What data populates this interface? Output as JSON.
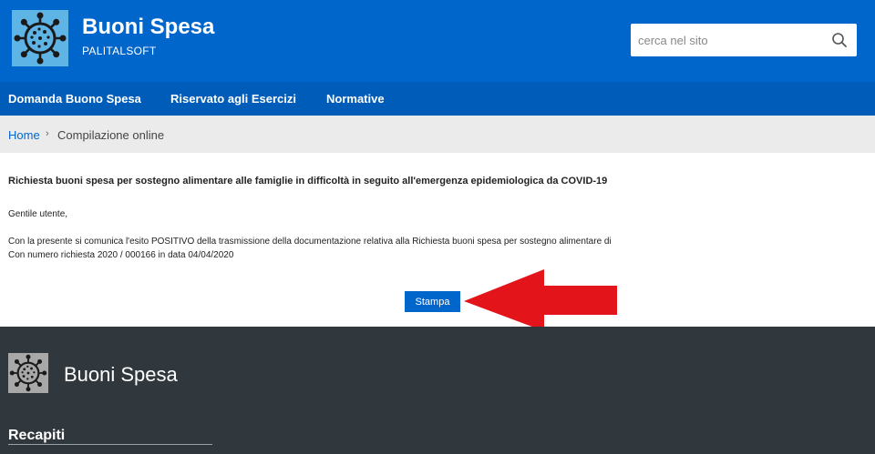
{
  "header": {
    "title": "Buoni Spesa",
    "subtitle": "PALITALSOFT",
    "logo_icon": "virus-icon",
    "search": {
      "placeholder": "cerca nel sito",
      "value": "",
      "icon": "search-icon"
    }
  },
  "nav": {
    "items": [
      {
        "label": "Domanda Buono Spesa"
      },
      {
        "label": "Riservato agli Esercizi"
      },
      {
        "label": "Normative"
      }
    ]
  },
  "breadcrumb": {
    "home": "Home",
    "separator": "›",
    "current": "Compilazione online"
  },
  "content": {
    "title": "Richiesta buoni spesa per sostegno alimentare alle famiglie in difficoltà in seguito all'emergenza epidemiologica da COVID-19",
    "greeting": "Gentile utente,",
    "line1": "Con la presente si comunica l'esito POSITIVO della trasmissione della documentazione relativa alla Richiesta buoni spesa per sostegno alimentare di",
    "line2": "Con numero richiesta 2020 / 000166 in data 04/04/2020",
    "print_label": "Stampa",
    "annotation_icon": "red-arrow-icon"
  },
  "footer": {
    "title": "Buoni Spesa",
    "heading": "Recapiti",
    "logo_icon": "virus-icon"
  },
  "colors": {
    "header_blue": "#0066cc",
    "nav_blue": "#005cb9",
    "logo_bg": "#5fb4e6",
    "footer_bg": "#30373d",
    "arrow_red": "#e3151a"
  }
}
